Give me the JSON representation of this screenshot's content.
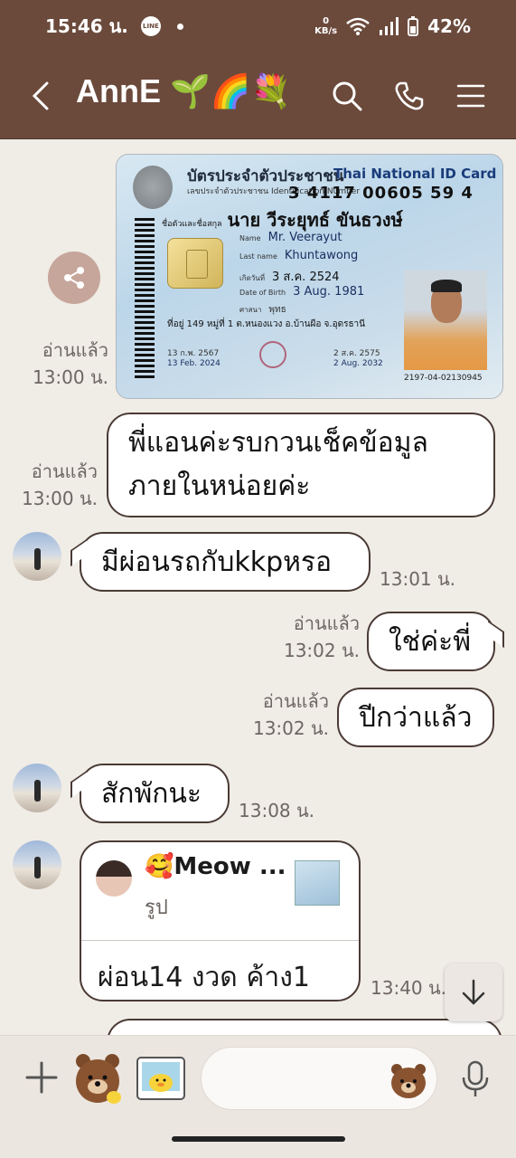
{
  "status_bar": {
    "time": "15:46 น.",
    "line_badge": "LINE",
    "net_speed_value": "0",
    "net_speed_unit": "KB/s",
    "battery": "42%"
  },
  "header": {
    "title": "AnnE 🌱🌈💐"
  },
  "messages": {
    "id_card": {
      "read_label": "อ่านแล้ว",
      "time": "13:00 น.",
      "card_title_th": "บัตรประจำตัวประชาชน",
      "card_title_en": "Thai National ID Card",
      "id_label": "เลขประจำตัวประชาชน Identification Number",
      "id_number": "3 4117 00605 59 4",
      "name_label": "ชื่อตัวและชื่อสกุล",
      "name_th": "นาย วีระยุทธ์ ขันธวงษ์",
      "name_label_en": "Name",
      "name_en": "Mr. Veerayut",
      "lastname_label_en": "Last name",
      "lastname_en": "Khuntawong",
      "dob_label_th": "เกิดวันที่",
      "dob_th": "3 ส.ค. 2524",
      "dob_label_en": "Date of Birth",
      "dob_en": "3 Aug. 1981",
      "religion_label": "ศาสนา",
      "religion": "พุทธ",
      "address": "ที่อยู่ 149 หมู่ที่ 1 ต.หนองแวง อ.บ้านผือ จ.อุดรธานี",
      "issue_th": "13 ก.พ. 2567",
      "issue_en": "13 Feb. 2024",
      "expiry_th": "2 ส.ค. 2575",
      "expiry_en": "2 Aug. 2032",
      "serial": "2197-04-02130945"
    },
    "m1": {
      "read_label": "อ่านแล้ว",
      "time": "13:00 น.",
      "text_line1": "พี่แอนค่ะรบกวนเช็คข้อมูล",
      "text_line2": "ภายในหน่อยค่ะ"
    },
    "m2": {
      "text": "มีผ่อนรถกับkkpหรอ",
      "time": "13:01 น."
    },
    "m3": {
      "read_label": "อ่านแล้ว",
      "time": "13:02 น.",
      "text": "ใช่ค่ะพี่"
    },
    "m4": {
      "read_label": "อ่านแล้ว",
      "time": "13:02 น.",
      "text": "ปีกว่าแล้ว"
    },
    "m5": {
      "text": "สักพักนะ",
      "time": "13:08 น."
    },
    "m6": {
      "quote_name": "🥰Meow ...",
      "quote_type": "รูป",
      "text": "ผ่อน14 งวด ค้าง1",
      "time": "13:40 น."
    }
  },
  "icons": {
    "back": "back-arrow-icon",
    "search": "search-icon",
    "call": "phone-icon",
    "menu": "hamburger-menu-icon",
    "share": "share-icon",
    "scroll_down": "arrow-down-icon",
    "plus": "plus-icon",
    "sticker": "brown-bear-sticker-icon",
    "photo_sticker": "photo-sticker-icon",
    "emoji": "brown-bear-emoji-icon",
    "mic": "microphone-icon"
  },
  "colors": {
    "header_bg": "#6b4a3c",
    "chat_bg": "#f0ece6",
    "bubble_border": "#4a3a35",
    "share_btn": "#c6a69b"
  }
}
